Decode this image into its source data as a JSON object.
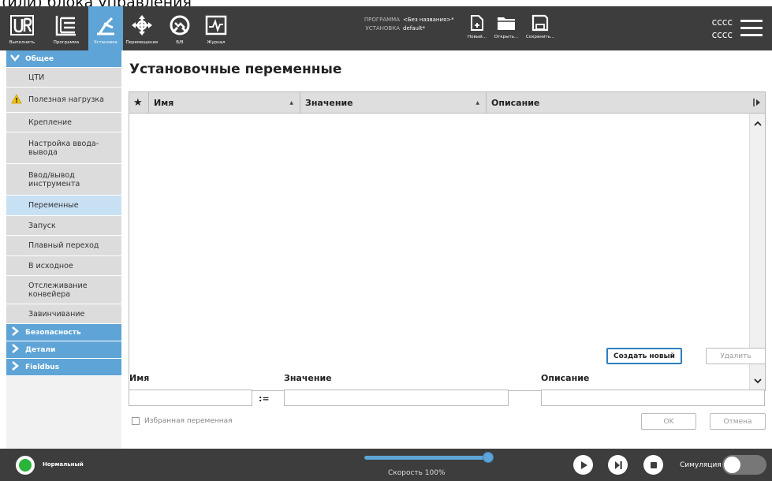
{
  "caption": "(или) блока управления",
  "header": {
    "nav": [
      {
        "label": "Выполнить",
        "icon": "ur-logo-icon"
      },
      {
        "label": "Программа",
        "icon": "program-icon"
      },
      {
        "label": "Установка",
        "icon": "installation-icon",
        "active": true
      },
      {
        "label": "Перемещение",
        "icon": "move-icon"
      },
      {
        "label": "В/В",
        "icon": "io-icon"
      },
      {
        "label": "Журнал",
        "icon": "log-icon"
      }
    ],
    "program_key": "ПРОГРАММА",
    "program_value": "<Без названия>*",
    "install_key": "УСТАНОВКА",
    "install_value": "default*",
    "file_buttons": [
      {
        "label": "Новый...",
        "icon": "new-file-icon"
      },
      {
        "label": "Открыть...",
        "icon": "folder-icon"
      },
      {
        "label": "Сохранить...",
        "icon": "save-icon"
      }
    ],
    "user_line1": "cccc",
    "user_line2": "cccc"
  },
  "sidebar": {
    "general": "Общее",
    "items": [
      {
        "label": "ЦТИ"
      },
      {
        "label": "Полезная нагрузка",
        "warning": true
      },
      {
        "label": "Крепление"
      },
      {
        "label": "Настройка ввода-вывода"
      },
      {
        "label": "Ввод/вывод инструмента"
      },
      {
        "label": "Переменные",
        "active": true
      },
      {
        "label": "Запуск"
      },
      {
        "label": "Плавный переход"
      },
      {
        "label": "В исходное"
      },
      {
        "label": "Отслеживание конвейера"
      },
      {
        "label": "Завинчивание"
      }
    ],
    "sections": [
      "Безопасность",
      "Детали",
      "Fieldbus"
    ]
  },
  "main": {
    "title": "Установочные переменные",
    "table": {
      "star": "★",
      "columns": [
        "Имя",
        "Значение",
        "Описание"
      ],
      "rows": []
    },
    "create_button": "Создать новый",
    "delete_button": "Удалить",
    "name_label": "Имя",
    "value_label": "Значение",
    "desc_label": "Описание",
    "assign": ":=",
    "favorite_label": "Избранная переменная",
    "ok_button": "OK",
    "cancel_button": "Отмена"
  },
  "footer": {
    "status": "Нормальный",
    "speed": "Скорость 100%",
    "speed_fraction": 1.0,
    "simulation": "Симуляция",
    "colors": {
      "status_ok": "#29b43a",
      "accent": "#5ea4d6"
    }
  }
}
